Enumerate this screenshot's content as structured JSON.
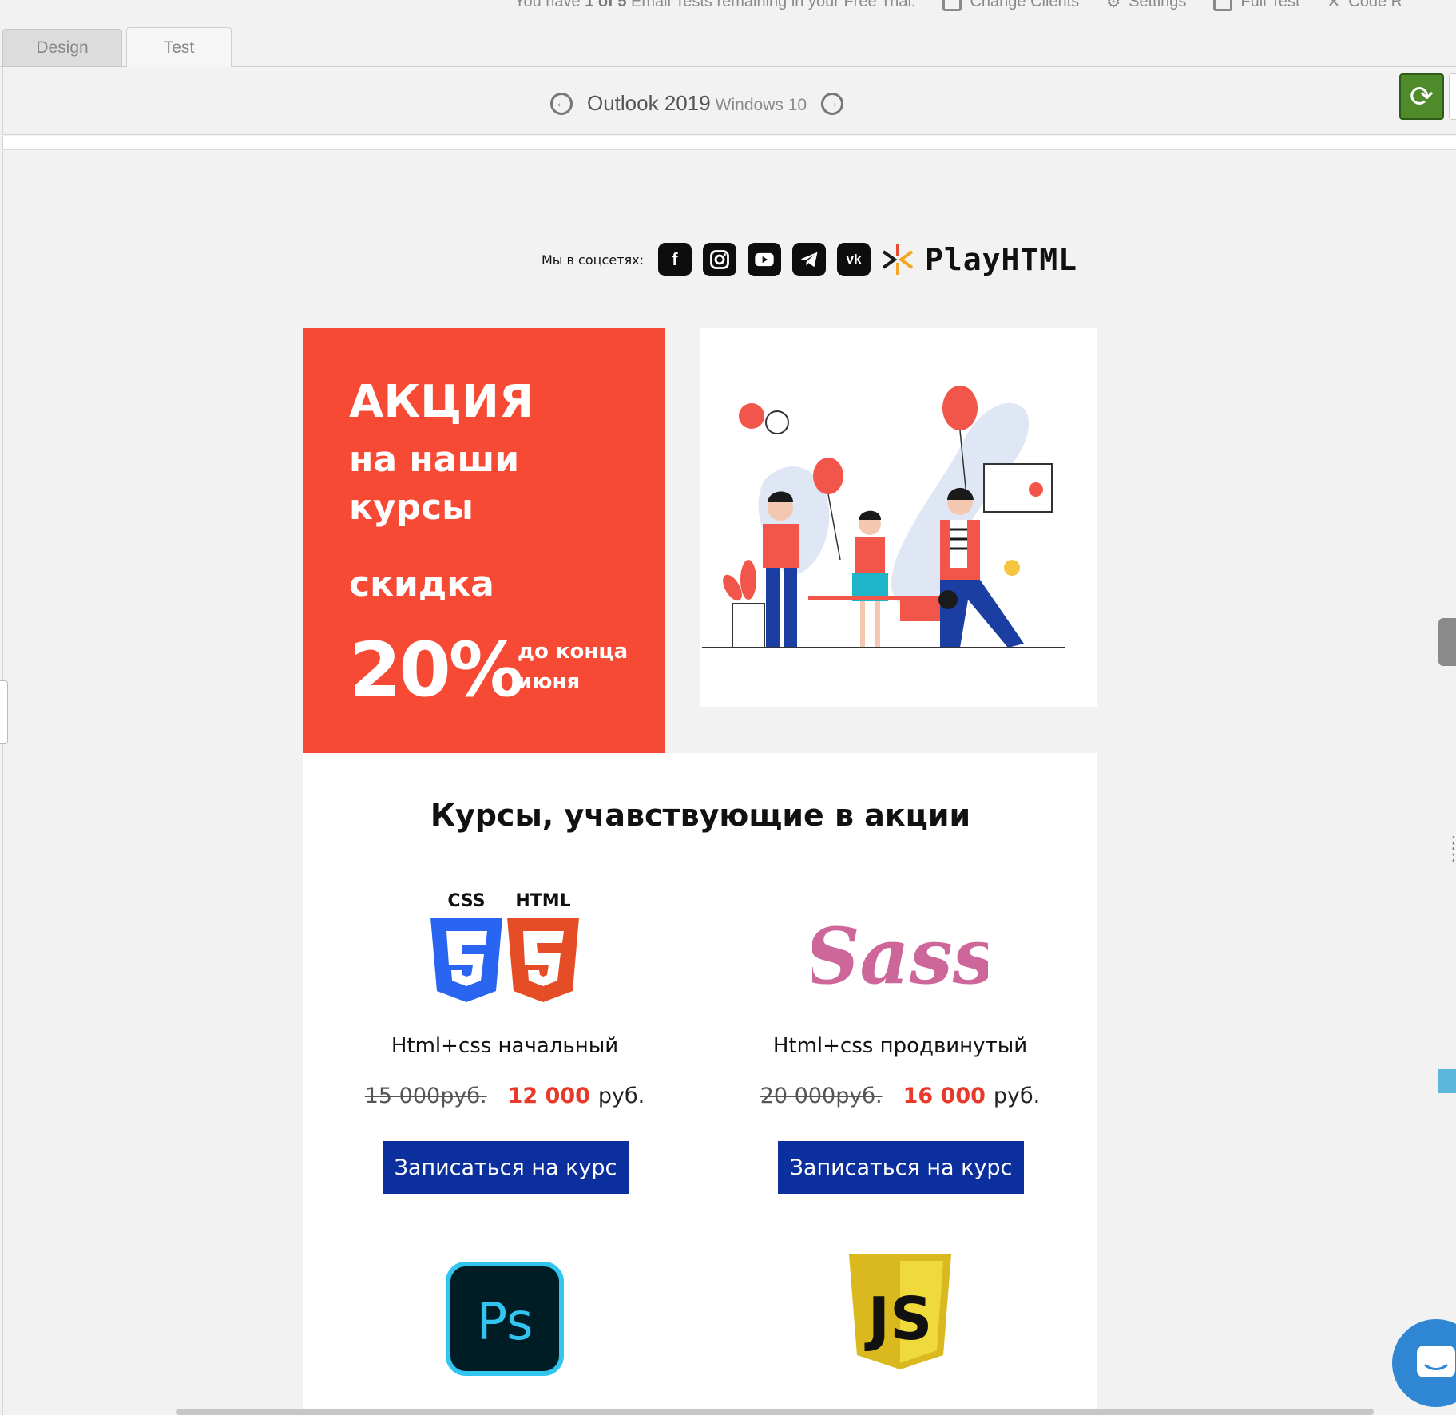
{
  "topbar": {
    "trial_prefix": "You have ",
    "trial_count": "1 of 5",
    "trial_suffix": " Email Tests remaining in your Free Trial.",
    "change_clients": "Change Clients",
    "settings": "Settings",
    "full_test": "Full Test",
    "code": "Code R"
  },
  "tabs": {
    "design": "Design",
    "test": "Test"
  },
  "client": {
    "name": "Outlook 2019",
    "os": "Windows 10"
  },
  "email": {
    "social_label": "Мы в соцсетях:",
    "brand": "PlayHTML",
    "promo": {
      "line1": "АКЦИЯ",
      "line2": "на наши курсы",
      "line3": "скидка",
      "percent": "20%",
      "until": "до конца июня"
    },
    "section_title": "Курсы, учавствующие в акции",
    "courses": [
      {
        "name": "Html+css начальный",
        "old_price": "15 000руб.",
        "new_price": "12 000",
        "currency": "руб.",
        "button": "Записаться на курс",
        "logo_text_1": "CSS",
        "logo_text_2": "HTML"
      },
      {
        "name": "Html+css продвинутый",
        "old_price": "20 000руб.",
        "new_price": "16 000",
        "currency": "руб.",
        "button": "Записаться на курс",
        "logo_text": "Sass"
      },
      {
        "logo_text": "Ps"
      },
      {
        "logo_text": "JS"
      }
    ]
  },
  "colors": {
    "promo_bg": "#f74a35",
    "button_bg": "#0c2f9e",
    "price_red": "#e8392a",
    "refresh_green": "#4f8b2a"
  },
  "icons": [
    "facebook-icon",
    "instagram-icon",
    "youtube-icon",
    "telegram-icon",
    "vk-icon",
    "refresh-icon",
    "chat-icon"
  ]
}
